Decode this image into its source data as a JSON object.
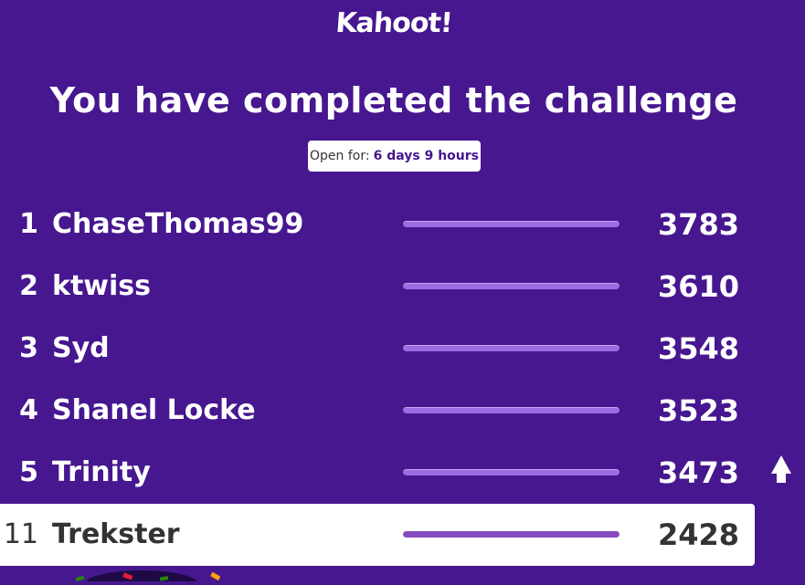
{
  "brand": {
    "logo_text": "Kahoot!"
  },
  "header": {
    "title": "You have completed the challenge",
    "open_label": "Open for:",
    "open_duration": "6 days 9 hours"
  },
  "leaderboard": {
    "rows": [
      {
        "rank": "1",
        "name": "ChaseThomas99",
        "score": "3783",
        "fill_percent": 100
      },
      {
        "rank": "2",
        "name": "ktwiss",
        "score": "3610",
        "fill_percent": 100
      },
      {
        "rank": "3",
        "name": "Syd",
        "score": "3548",
        "fill_percent": 100
      },
      {
        "rank": "4",
        "name": "Shanel Locke",
        "score": "3523",
        "fill_percent": 100
      },
      {
        "rank": "5",
        "name": "Trinity",
        "score": "3473",
        "fill_percent": 100
      }
    ],
    "current_user": {
      "rank": "11",
      "name": "Trekster",
      "score": "2428",
      "fill_percent": 100
    }
  },
  "icons": {
    "scroll_top": "arrow-up-icon",
    "mascot": "confetti-icon"
  },
  "colors": {
    "background": "#46178f",
    "bar_fill": "#9b6ce4",
    "highlight_row": "#ffffff"
  }
}
